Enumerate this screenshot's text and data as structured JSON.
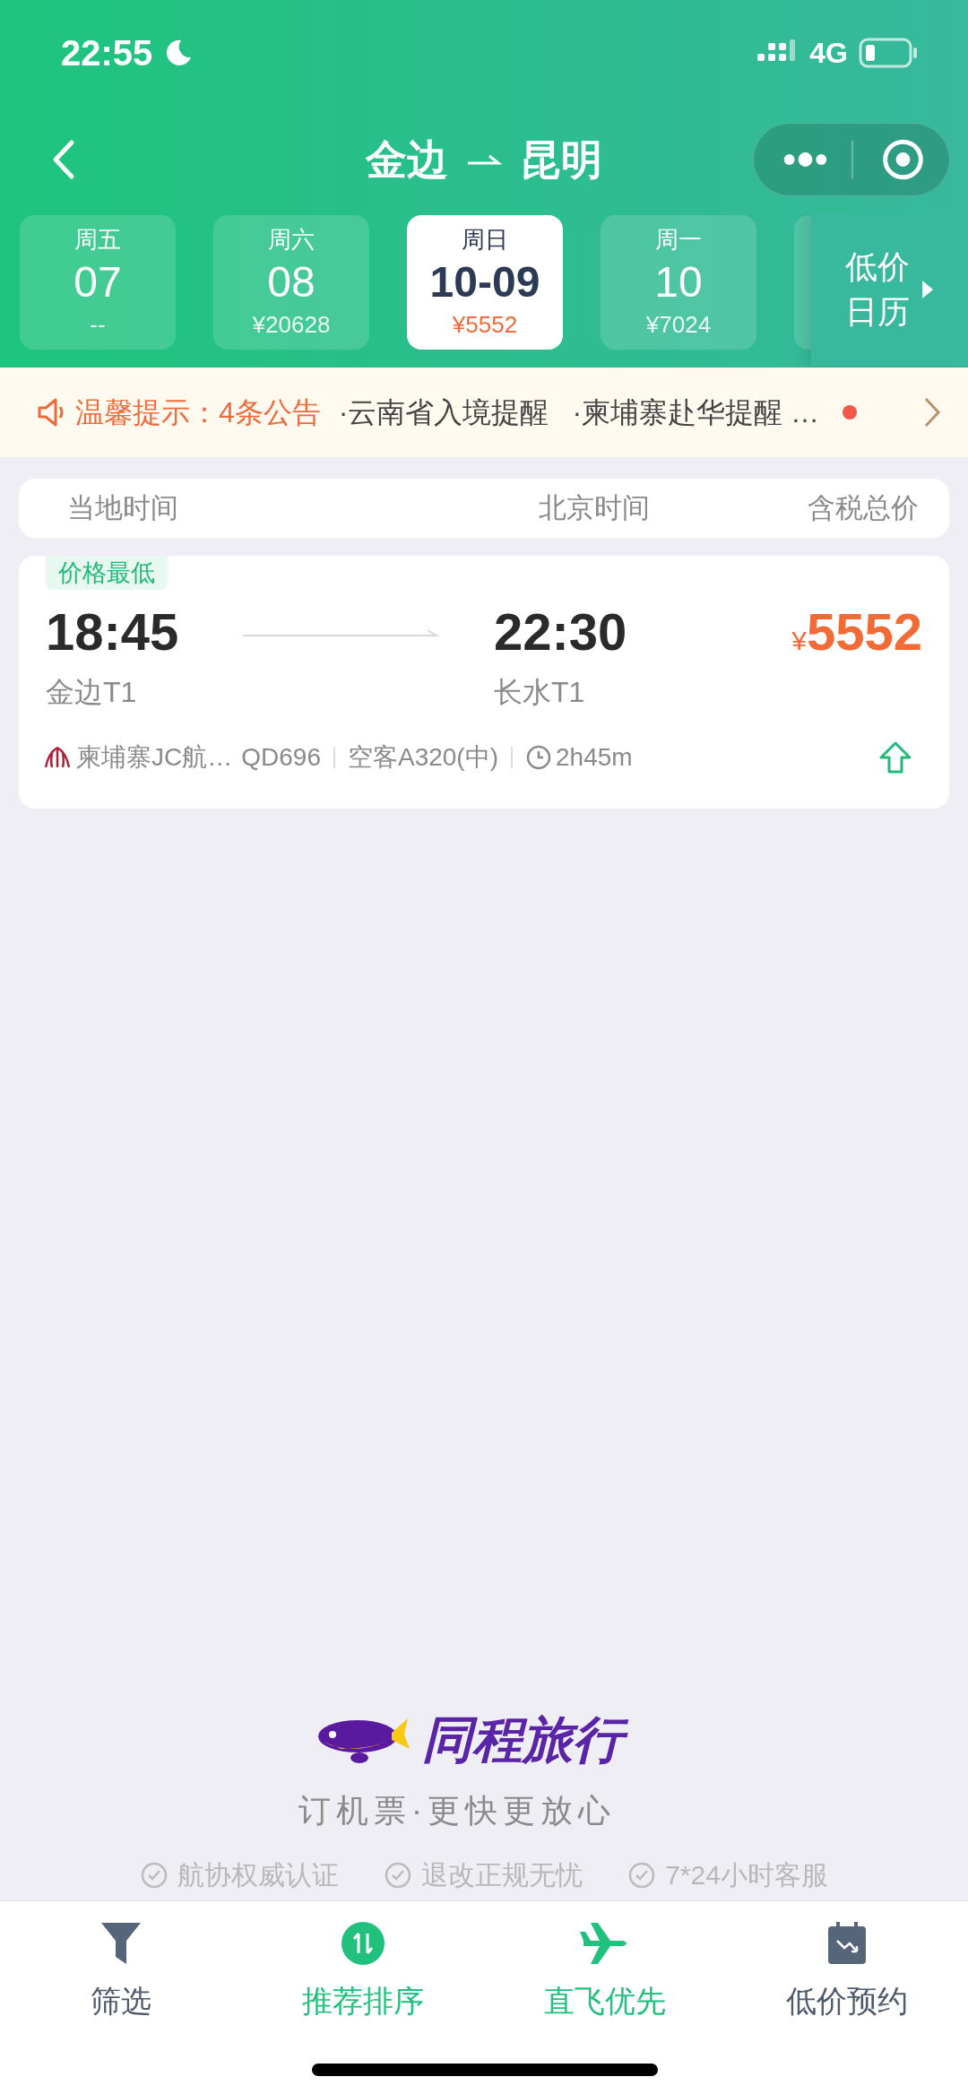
{
  "status_bar": {
    "time": "22:55",
    "network": "4G"
  },
  "header": {
    "from": "金边",
    "to": "昆明"
  },
  "date_tabs": [
    {
      "weekday": "周五",
      "date": "07",
      "price": "--",
      "selected": false
    },
    {
      "weekday": "周六",
      "date": "08",
      "price": "¥20628",
      "selected": false
    },
    {
      "weekday": "周日",
      "date": "10-09",
      "price": "¥5552",
      "selected": true
    },
    {
      "weekday": "周一",
      "date": "10",
      "price": "¥7024",
      "selected": false
    }
  ],
  "calendar_button": {
    "line_1": "低价",
    "line_2": "日历"
  },
  "notice": {
    "label": "温馨提示：",
    "count": "4条公告",
    "items": [
      "·云南省入境提醒",
      "·柬埔寨赴华提醒 …"
    ],
    "unread": true
  },
  "columns": [
    "当地时间",
    "北京时间",
    "含税总价"
  ],
  "flights": [
    {
      "tag": "价格最低",
      "depart_time": "18:45",
      "depart_airport": "金边T1",
      "arrive_time": "22:30",
      "arrive_airport": "长水T1",
      "currency": "¥",
      "price": "5552",
      "airline": "柬埔寨JC航…",
      "flight_no": "QD696",
      "aircraft": "空客A320(中)",
      "duration": "2h45m"
    }
  ],
  "brand": {
    "name": "同程旅行",
    "slogan": "订机票·更快更放心"
  },
  "assurances": [
    "航协权威认证",
    "退改正规无忧",
    "7*24小时客服"
  ],
  "bottom_nav": [
    {
      "label": "筛选",
      "kind": "filter",
      "selected": false
    },
    {
      "label": "推荐排序",
      "kind": "sort",
      "selected": true
    },
    {
      "label": "直飞优先",
      "kind": "direct",
      "selected": true
    },
    {
      "label": "低价预约",
      "kind": "calendar",
      "selected": false
    }
  ]
}
